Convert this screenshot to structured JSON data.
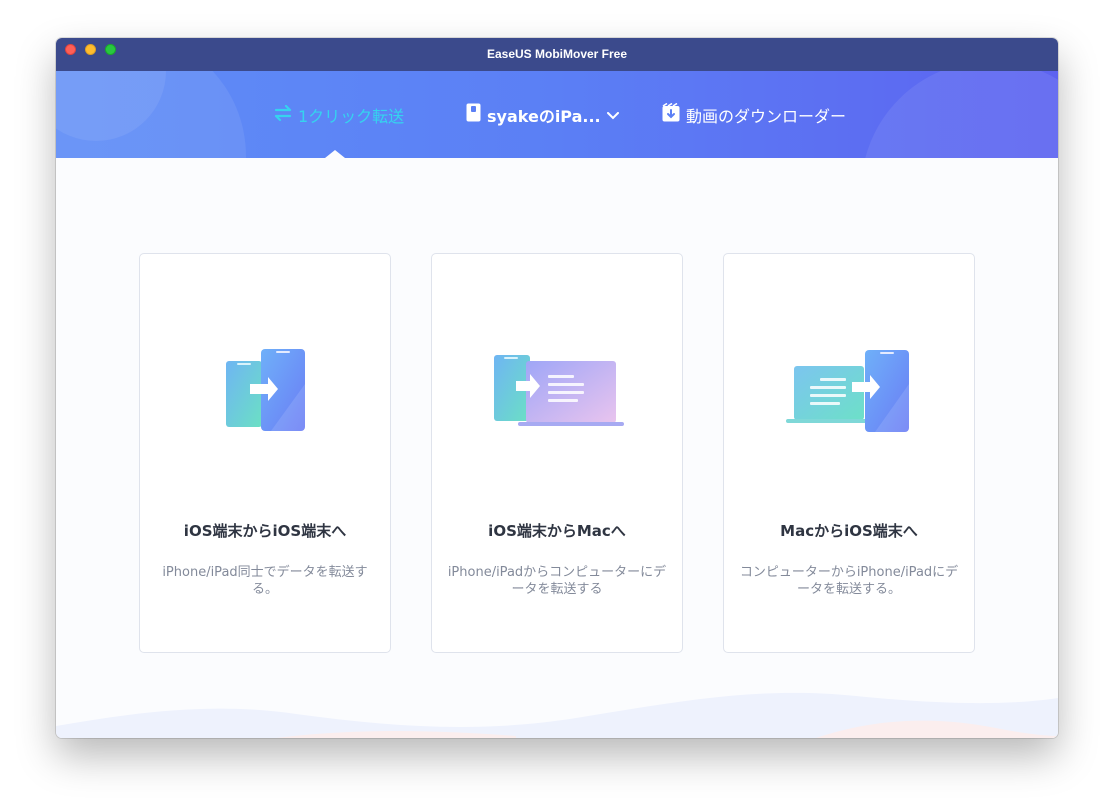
{
  "window": {
    "title": "EaseUS MobiMover Free"
  },
  "nav": [
    {
      "label": "1クリック転送",
      "icon": "transfer-arrows-icon",
      "active": true
    },
    {
      "label": "syakeのiPa...",
      "icon": "phone-device-icon",
      "active": false
    },
    {
      "label": "動画のダウンローダー",
      "icon": "video-download-icon",
      "active": false
    }
  ],
  "cards": [
    {
      "title": "iOS端末からiOS端末へ",
      "description": "iPhone/iPad同士でデータを転送する。",
      "icon": "phone-to-phone-icon"
    },
    {
      "title": "iOS端末からMacへ",
      "description": "iPhone/iPadからコンピューターにデータを転送する",
      "icon": "phone-to-computer-icon"
    },
    {
      "title": "MacからiOS端末へ",
      "description": "コンピューターからiPhone/iPadにデータを転送する。",
      "icon": "computer-to-phone-icon"
    }
  ],
  "colors": {
    "titlebar": "#3b4a8c",
    "header_start": "#5f8df7",
    "header_end": "#5d63f0",
    "active_tab": "#35d3ef"
  }
}
